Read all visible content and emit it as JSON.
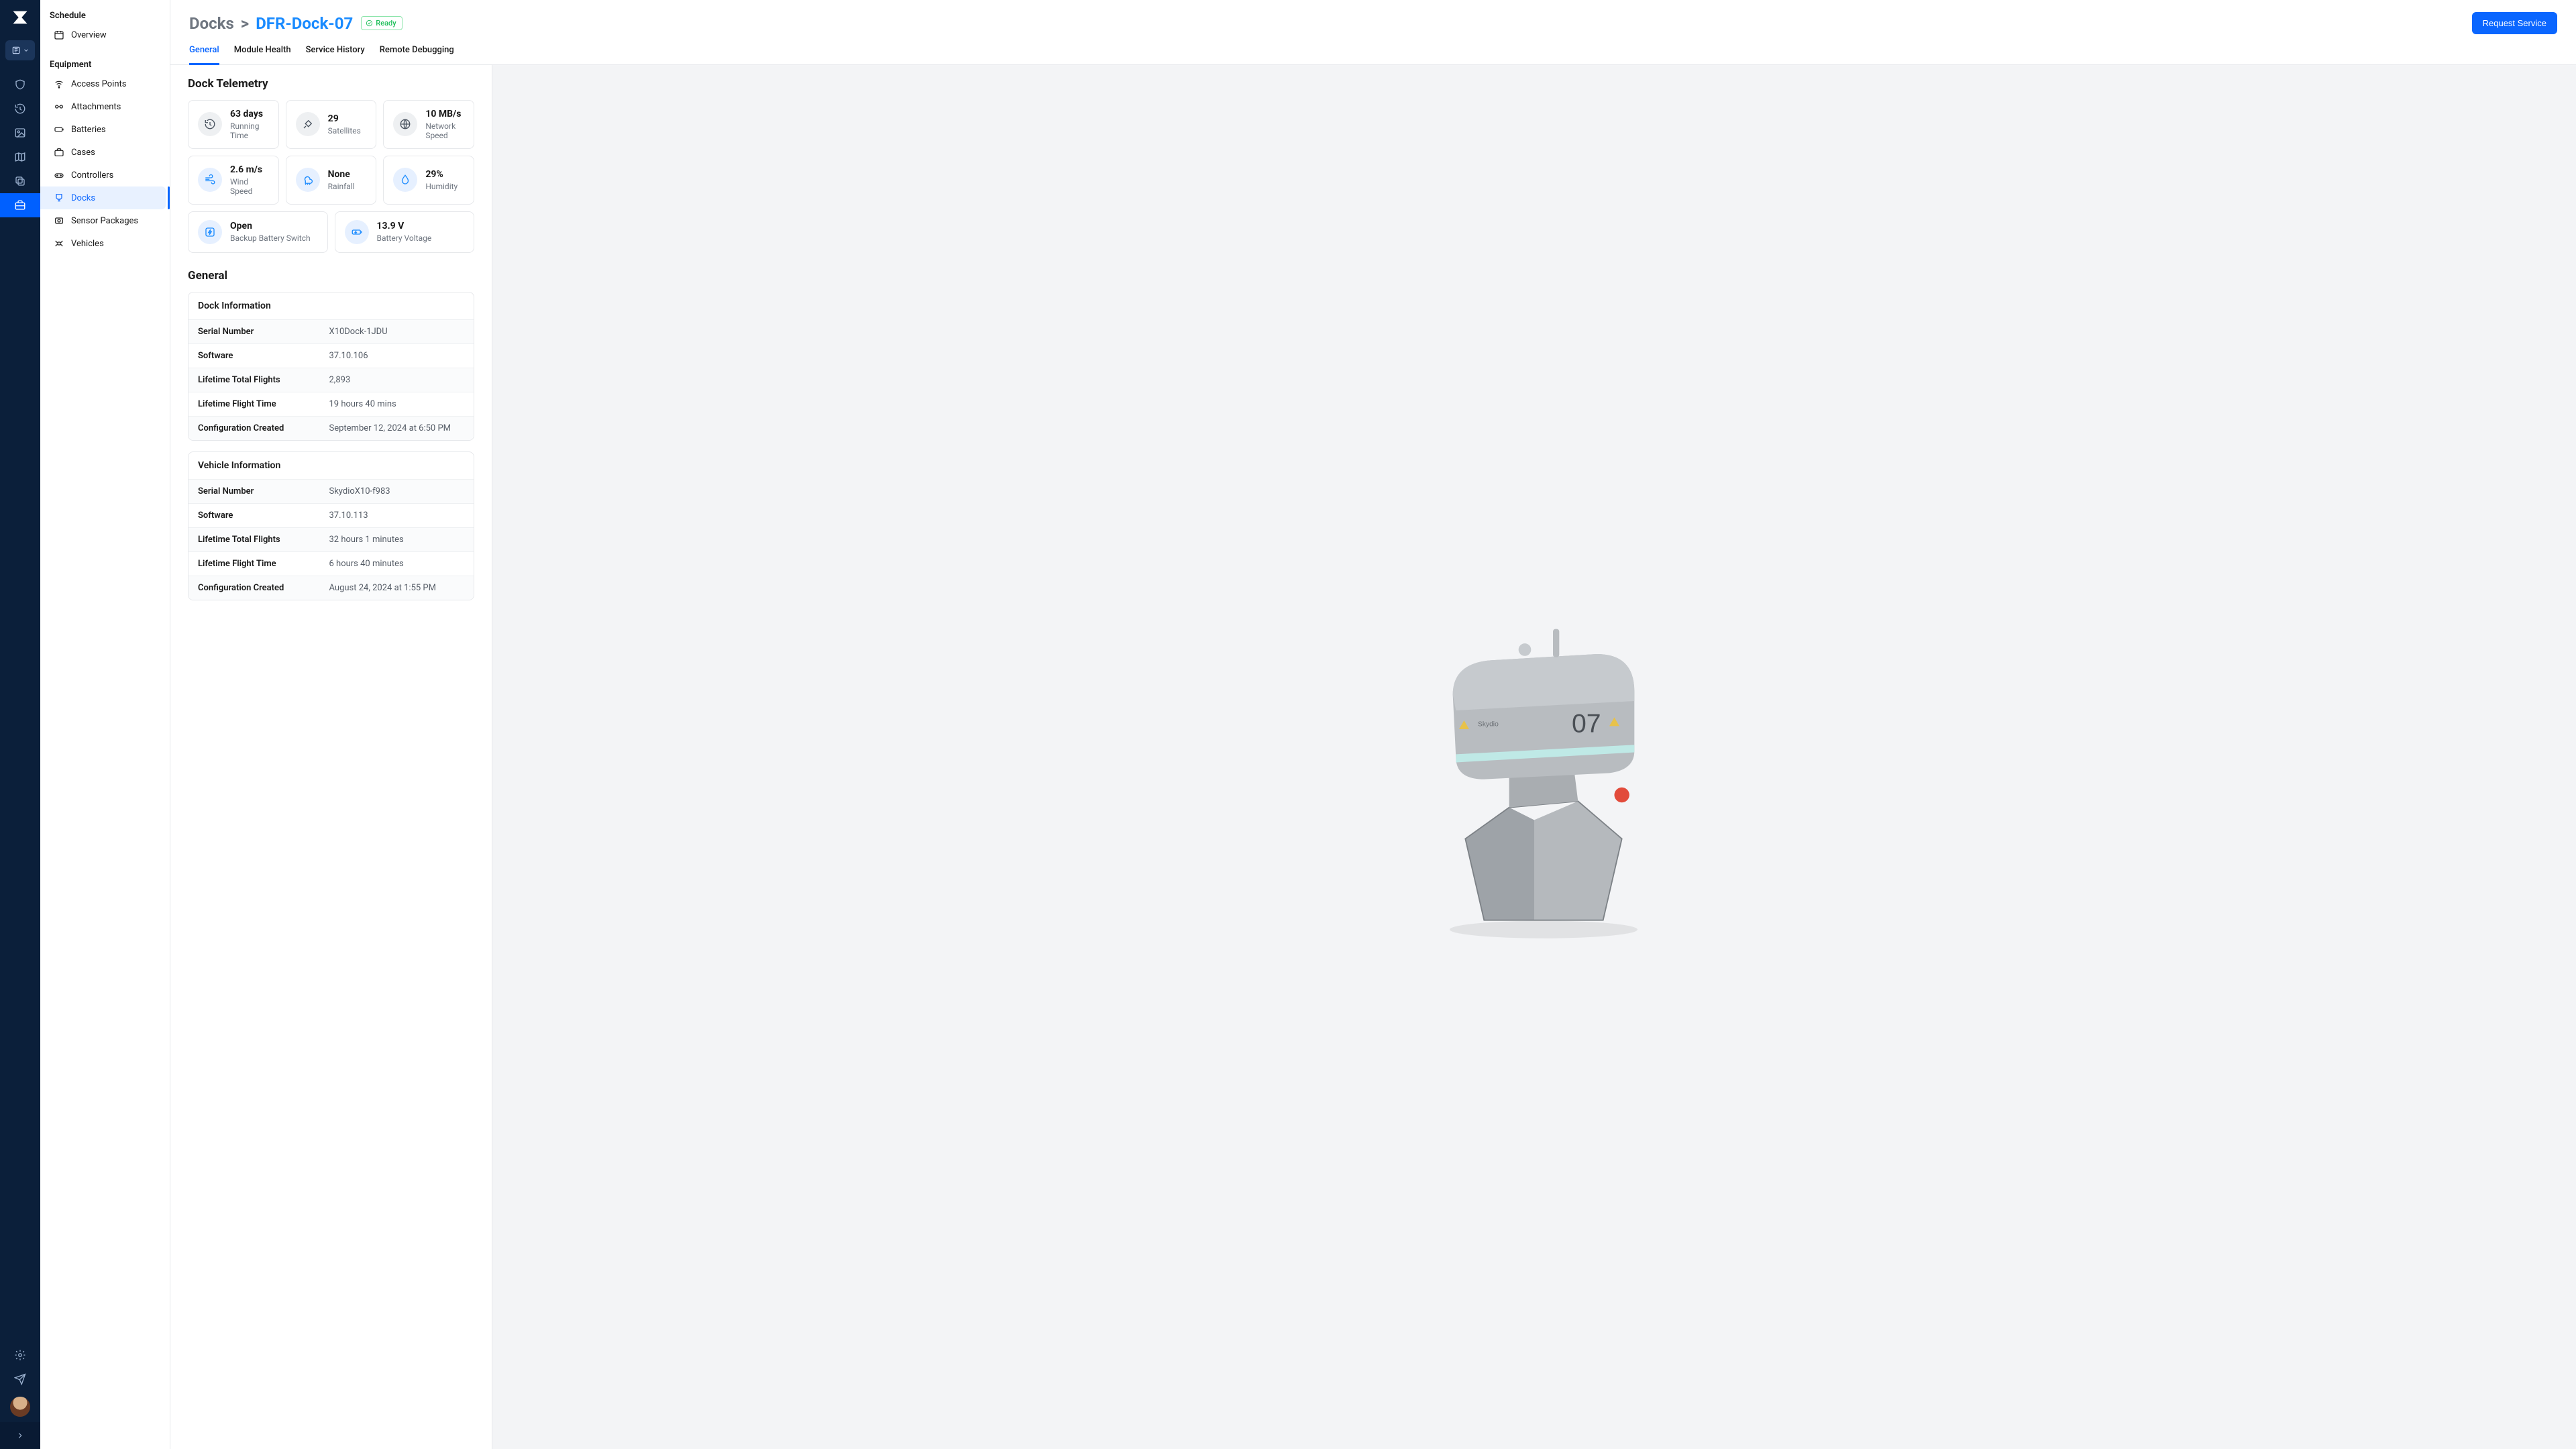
{
  "rail": {
    "selector_icon": "building",
    "items": [
      "shield",
      "history",
      "image",
      "map",
      "layers",
      "briefcase"
    ],
    "active_index": 5,
    "footer": [
      "settings",
      "send"
    ]
  },
  "sidebar": {
    "schedule": {
      "title": "Schedule",
      "items": [
        {
          "icon": "calendar",
          "label": "Overview"
        }
      ]
    },
    "equipment": {
      "title": "Equipment",
      "items": [
        {
          "icon": "wifi",
          "label": "Access Points"
        },
        {
          "icon": "link",
          "label": "Attachments"
        },
        {
          "icon": "battery",
          "label": "Batteries"
        },
        {
          "icon": "case",
          "label": "Cases"
        },
        {
          "icon": "gamepad",
          "label": "Controllers"
        },
        {
          "icon": "dock",
          "label": "Docks"
        },
        {
          "icon": "sensor",
          "label": "Sensor Packages"
        },
        {
          "icon": "drone",
          "label": "Vehicles"
        }
      ],
      "active_index": 5
    }
  },
  "header": {
    "parent": "Docks",
    "separator": ">",
    "current": "DFR-Dock-07",
    "badge": {
      "text": "Ready",
      "icon": "check"
    },
    "action": "Request Service"
  },
  "tabs": {
    "items": [
      "General",
      "Module Health",
      "Service History",
      "Remote Debugging"
    ],
    "active_index": 0
  },
  "telemetry": {
    "title": "Dock Telemetry",
    "cards": [
      {
        "icon": "time",
        "tone": "gray",
        "value": "63 days",
        "label": "Running Time"
      },
      {
        "icon": "sat",
        "tone": "gray",
        "value": "29",
        "label": "Satellites"
      },
      {
        "icon": "net",
        "tone": "gray",
        "value": "10 MB/s",
        "label": "Network Speed"
      },
      {
        "icon": "wind",
        "tone": "blue",
        "value": "2.6 m/s",
        "label": "Wind Speed"
      },
      {
        "icon": "rain",
        "tone": "blue",
        "value": "None",
        "label": "Rainfall"
      },
      {
        "icon": "drop",
        "tone": "blue",
        "value": "29%",
        "label": "Humidity"
      },
      {
        "icon": "bolt",
        "tone": "blue",
        "value": "Open",
        "label": "Backup Battery Switch",
        "wide": true
      },
      {
        "icon": "batt",
        "tone": "blue",
        "value": "13.9 V",
        "label": "Battery Voltage",
        "wide": true
      }
    ]
  },
  "general": {
    "title": "General",
    "blocks": [
      {
        "title": "Dock Information",
        "rows": [
          {
            "k": "Serial Number",
            "v": "X10Dock-1JDU"
          },
          {
            "k": "Software",
            "v": "37.10.106"
          },
          {
            "k": "Lifetime Total Flights",
            "v": "2,893"
          },
          {
            "k": "Lifetime Flight Time",
            "v": "19 hours 40 mins"
          },
          {
            "k": "Configuration Created",
            "v": "September 12, 2024 at 6:50 PM"
          }
        ]
      },
      {
        "title": "Vehicle Information",
        "rows": [
          {
            "k": "Serial Number",
            "v": "SkydioX10-f983"
          },
          {
            "k": "Software",
            "v": "37.10.113"
          },
          {
            "k": "Lifetime Total Flights",
            "v": "32 hours 1 minutes"
          },
          {
            "k": "Lifetime Flight Time",
            "v": "6 hours 40 minutes"
          },
          {
            "k": "Configuration Created",
            "v": "August 24, 2024 at 1:55 PM"
          }
        ]
      }
    ]
  },
  "preview": {
    "label_on_body": "07",
    "brand": "Skydio"
  }
}
